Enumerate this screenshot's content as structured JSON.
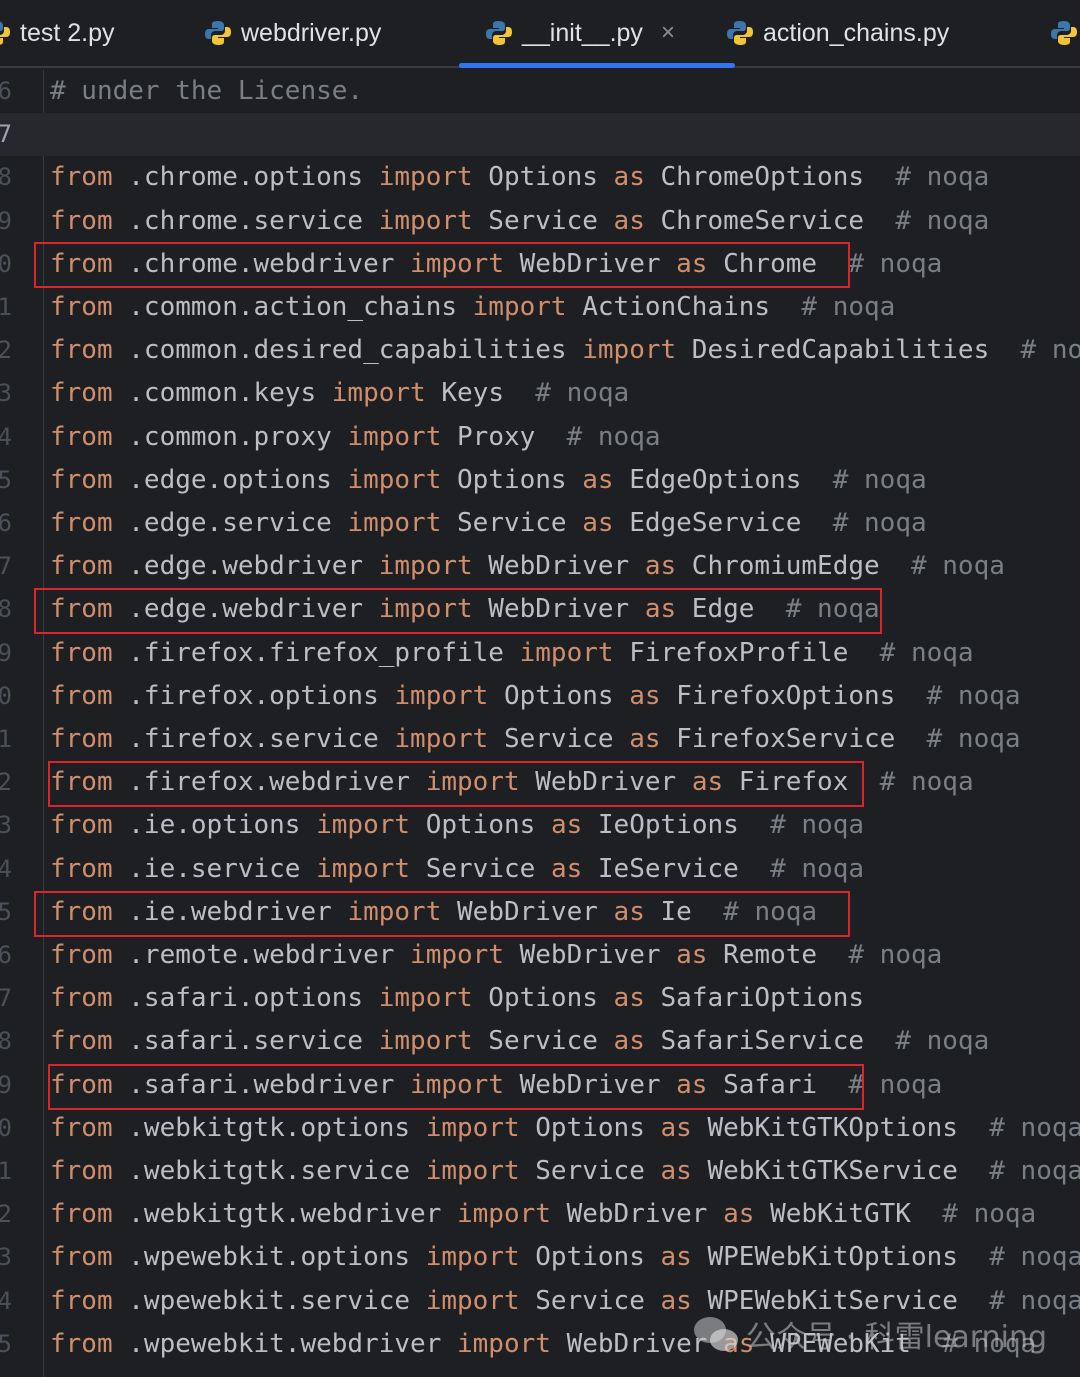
{
  "tabs": [
    {
      "label": "test 2.py",
      "icon": "python-icon",
      "active": false
    },
    {
      "label": "webdriver.py",
      "icon": "python-icon",
      "active": false
    },
    {
      "label": "__init__.py",
      "icon": "python-icon",
      "active": true,
      "close": "×"
    },
    {
      "label": "action_chains.py",
      "icon": "python-icon",
      "active": false
    },
    {
      "label": "",
      "icon": "python-icon",
      "active": false
    }
  ],
  "colors": {
    "keyword": "#cf8e6d",
    "text": "#bcbec4",
    "comment": "#7a7e85",
    "accent": "#3574f0",
    "highlight_box": "#d9262b"
  },
  "lines": [
    {
      "num": "6",
      "text": "# under the License."
    },
    {
      "num": "7",
      "text": "",
      "current": true
    },
    {
      "num": "8",
      "text": "from .chrome.options import Options as ChromeOptions  # noqa"
    },
    {
      "num": "9",
      "text": "from .chrome.service import Service as ChromeService  # noqa"
    },
    {
      "num": "0",
      "text": "from .chrome.webdriver import WebDriver as Chrome  # noqa",
      "boxed": true
    },
    {
      "num": "1",
      "text": "from .common.action_chains import ActionChains  # noqa"
    },
    {
      "num": "2",
      "text": "from .common.desired_capabilities import DesiredCapabilities  # noqa"
    },
    {
      "num": "3",
      "text": "from .common.keys import Keys  # noqa"
    },
    {
      "num": "4",
      "text": "from .common.proxy import Proxy  # noqa"
    },
    {
      "num": "5",
      "text": "from .edge.options import Options as EdgeOptions  # noqa"
    },
    {
      "num": "6",
      "text": "from .edge.service import Service as EdgeService  # noqa"
    },
    {
      "num": "7",
      "text": "from .edge.webdriver import WebDriver as ChromiumEdge  # noqa"
    },
    {
      "num": "8",
      "text": "from .edge.webdriver import WebDriver as Edge  # noqa",
      "boxed": true
    },
    {
      "num": "9",
      "text": "from .firefox.firefox_profile import FirefoxProfile  # noqa"
    },
    {
      "num": "0",
      "text": "from .firefox.options import Options as FirefoxOptions  # noqa"
    },
    {
      "num": "1",
      "text": "from .firefox.service import Service as FirefoxService  # noqa"
    },
    {
      "num": "2",
      "text": "from .firefox.webdriver import WebDriver as Firefox  # noqa",
      "boxed": true
    },
    {
      "num": "3",
      "text": "from .ie.options import Options as IeOptions  # noqa"
    },
    {
      "num": "4",
      "text": "from .ie.service import Service as IeService  # noqa"
    },
    {
      "num": "5",
      "text": "from .ie.webdriver import WebDriver as Ie  # noqa",
      "boxed": true
    },
    {
      "num": "6",
      "text": "from .remote.webdriver import WebDriver as Remote  # noqa"
    },
    {
      "num": "7",
      "text": "from .safari.options import Options as SafariOptions"
    },
    {
      "num": "8",
      "text": "from .safari.service import Service as SafariService  # noqa"
    },
    {
      "num": "9",
      "text": "from .safari.webdriver import WebDriver as Safari  # noqa",
      "boxed": true
    },
    {
      "num": "0",
      "text": "from .webkitgtk.options import Options as WebKitGTKOptions  # noqa"
    },
    {
      "num": "1",
      "text": "from .webkitgtk.service import Service as WebKitGTKService  # noqa"
    },
    {
      "num": "2",
      "text": "from .webkitgtk.webdriver import WebDriver as WebKitGTK  # noqa"
    },
    {
      "num": "3",
      "text": "from .wpewebkit.options import Options as WPEWebKitOptions  # noqa"
    },
    {
      "num": "4",
      "text": "from .wpewebkit.service import Service as WPEWebKitService  # noqa"
    },
    {
      "num": "5",
      "text": "from .wpewebkit.webdriver import WebDriver as WPEWebKit  # noqa"
    }
  ],
  "watermark": {
    "text": "公众号 · 科雷learning",
    "icon": "wechat-icon"
  }
}
